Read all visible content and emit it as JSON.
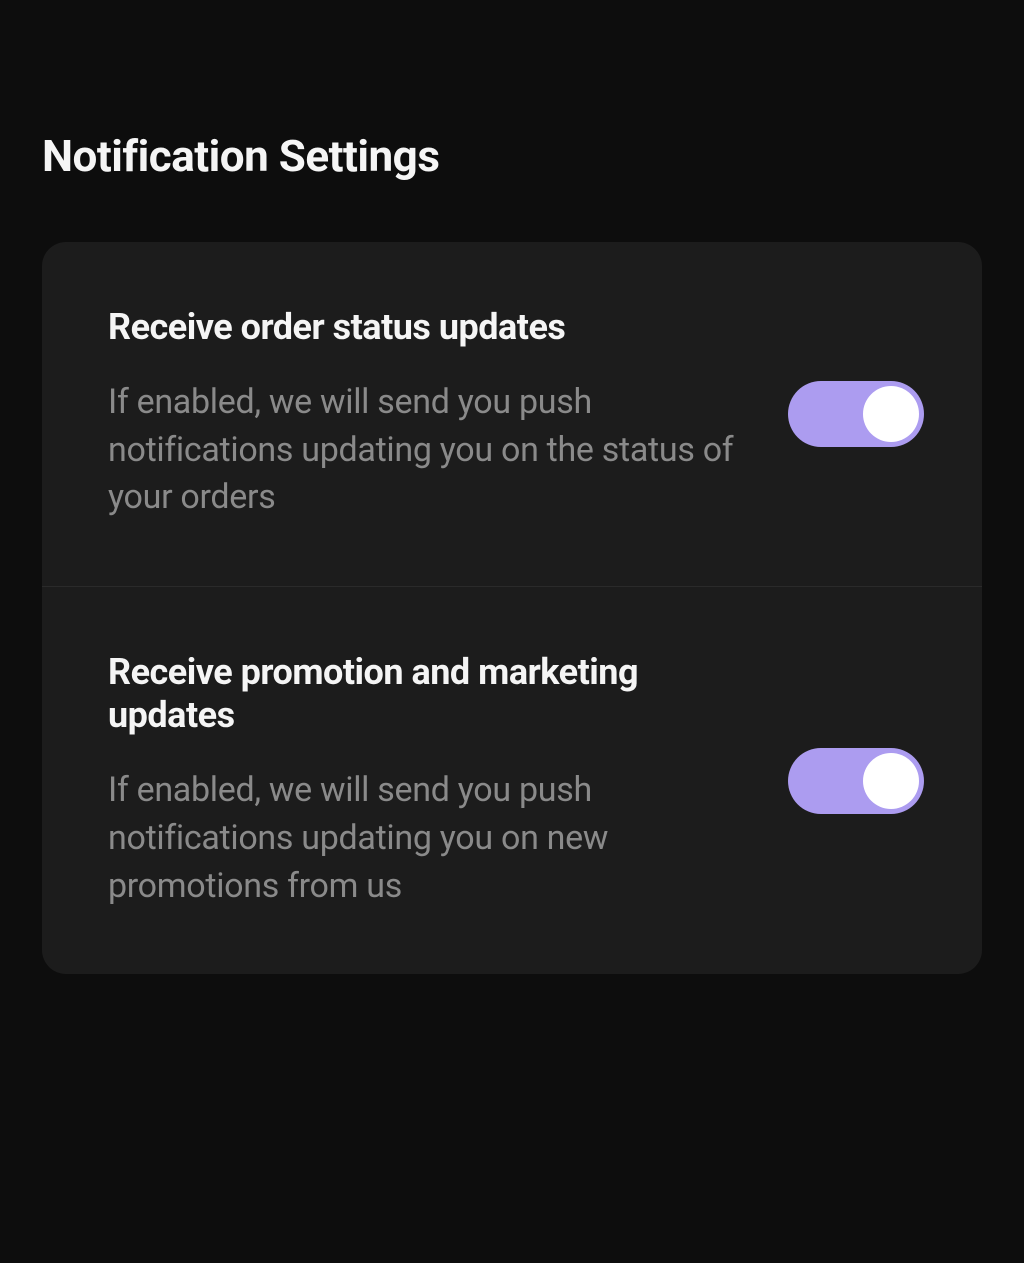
{
  "header": {
    "title": "Notification Settings"
  },
  "settings": [
    {
      "title": "Receive order status updates",
      "description": "If enabled, we will send you push notifications updating you on the status of your orders",
      "enabled": true
    },
    {
      "title": "Receive promotion and marketing updates",
      "description": "If enabled, we will send you push notifications updating you on new promotions from us",
      "enabled": true
    }
  ],
  "colors": {
    "background": "#0d0d0d",
    "card": "#1c1c1c",
    "toggle_on": "#ac9cf0",
    "text_primary": "#f5f5f5",
    "text_secondary": "#8a8a8a"
  }
}
